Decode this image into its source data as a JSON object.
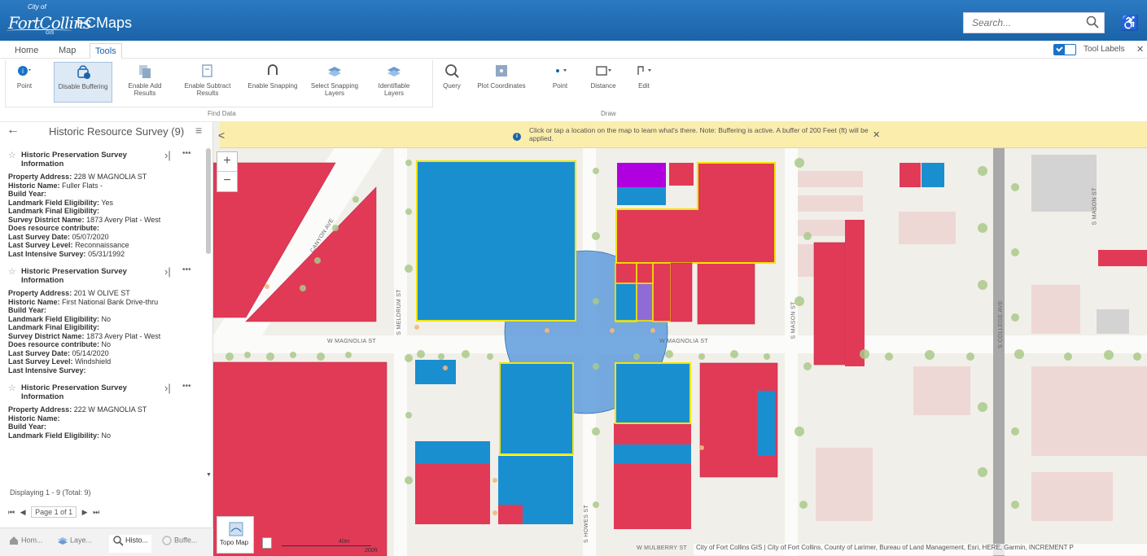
{
  "header": {
    "logo_city": "City of",
    "logo_fort_collins": "FortCollins",
    "logo_app": "FCMaps",
    "logo_gis": "GIS",
    "search_placeholder": "Search...",
    "search_icon": "search-icon",
    "accessibility_icon": "accessibility-icon"
  },
  "tabs": [
    {
      "label": "Home"
    },
    {
      "label": "Map"
    },
    {
      "label": "Tools"
    }
  ],
  "tool_labels": {
    "label": "Tool Labels",
    "checked": true,
    "close": "✕"
  },
  "ribbon": {
    "find_data": {
      "group_label": "Find Data",
      "buttons": [
        {
          "label": "Point",
          "icon": "identify-point-icon"
        },
        {
          "label": "Disable Buffering",
          "icon": "buffer-icon"
        },
        {
          "label": "Enable Add Results",
          "icon": "add-results-icon"
        },
        {
          "label": "Enable Subtract Results",
          "icon": "subtract-results-icon"
        },
        {
          "label": "Enable Snapping",
          "icon": "snapping-icon"
        },
        {
          "label": "Select Snapping Layers",
          "icon": "snapping-layers-icon"
        },
        {
          "label": "Identifiable Layers",
          "icon": "identifiable-layers-icon"
        }
      ]
    },
    "draw": {
      "group_label": "Draw",
      "buttons": [
        {
          "label": "Query",
          "icon": "query-icon"
        },
        {
          "label": "Plot Coordinates",
          "icon": "plot-coordinates-icon"
        },
        {
          "label": "Point",
          "icon": "draw-point-icon"
        },
        {
          "label": "Distance",
          "icon": "distance-icon"
        },
        {
          "label": "Edit",
          "icon": "edit-icon"
        }
      ]
    }
  },
  "panel": {
    "back_icon": "←",
    "title": "Historic Resource Survey (9)",
    "menu_icon": "≡",
    "collapse_icon": "<",
    "results": [
      {
        "title": "Historic Preservation Survey Information",
        "fields": [
          {
            "label": "Property Address:",
            "value": "228 W MAGNOLIA ST"
          },
          {
            "label": "Historic Name:",
            "value": "Fuller Flats -"
          },
          {
            "label": "Build Year:",
            "value": ""
          },
          {
            "label": "Landmark Field Eligibility:",
            "value": "Yes"
          },
          {
            "label": "Landmark Final Eligibility:",
            "value": ""
          },
          {
            "label": "Survey District Name:",
            "value": "1873 Avery Plat - West"
          },
          {
            "label": "Does resource contribute:",
            "value": ""
          },
          {
            "label": "Last Survey Date:",
            "value": "05/07/2020"
          },
          {
            "label": "Last Survey Level:",
            "value": "Reconnaissance"
          },
          {
            "label": "Last Intensive Survey:",
            "value": "05/31/1992"
          }
        ]
      },
      {
        "title": "Historic Preservation Survey Information",
        "fields": [
          {
            "label": "Property Address:",
            "value": "201 W OLIVE ST"
          },
          {
            "label": "Historic Name:",
            "value": "First National Bank Drive-thru"
          },
          {
            "label": "Build Year:",
            "value": ""
          },
          {
            "label": "Landmark Field Eligibility:",
            "value": "No"
          },
          {
            "label": "Landmark Final Eligibility:",
            "value": ""
          },
          {
            "label": "Survey District Name:",
            "value": "1873 Avery Plat - West"
          },
          {
            "label": "Does resource contribute:",
            "value": "No"
          },
          {
            "label": "Last Survey Date:",
            "value": "05/14/2020"
          },
          {
            "label": "Last Survey Level:",
            "value": "Windshield"
          },
          {
            "label": "Last Intensive Survey:",
            "value": ""
          }
        ]
      },
      {
        "title": "Historic Preservation Survey Information",
        "fields": [
          {
            "label": "Property Address:",
            "value": "222 W MAGNOLIA ST"
          },
          {
            "label": "Historic Name:",
            "value": ""
          },
          {
            "label": "Build Year:",
            "value": ""
          },
          {
            "label": "Landmark Field Eligibility:",
            "value": "No"
          }
        ]
      }
    ],
    "display_text": "Displaying 1 - 9 (Total: 9)",
    "pager": {
      "first": "⏮",
      "prev": "◀",
      "page_text": "Page 1 of 1",
      "next": "▶",
      "last": "⏭"
    }
  },
  "bottom_tabs": [
    {
      "label": "Hom...",
      "icon": "home-icon"
    },
    {
      "label": "Laye...",
      "icon": "layers-icon"
    },
    {
      "label": "Histo...",
      "icon": "search-results-icon"
    },
    {
      "label": "Buffe...",
      "icon": "buffer-tab-icon"
    }
  ],
  "map": {
    "notice_text": "Click or tap a location on the map to learn what's there. Note: Buffering is active. A buffer of 200 Feet (ft) will be applied.",
    "notice_close": "✕",
    "zoom_in": "+",
    "zoom_out": "−",
    "basemap_label": "Topo Map",
    "scale_meters": "40m",
    "scale_feet": "200ft",
    "streets": {
      "canyon_ave": "CANYON AVE",
      "w_magnolia_1": "W MAGNOLIA ST",
      "w_magnolia_2": "W MAGNOLIA ST",
      "s_mason": "S MASON ST",
      "w_mulberry": "W MULBERRY ST",
      "s_howes": "S HOWES ST",
      "s_meldrum": "S MELDRUM ST",
      "s_college": "S COLLEGE AVE",
      "s_mason_w": "S MASON ST"
    },
    "attribution": "City of Fort Collins GIS | City of Fort Collins, County of Larimer, Bureau of Land Management, Esri, HERE, Garmin, INCREMENT P",
    "colors": {
      "selected": "#1a8fd0",
      "unselected": "#e03a57",
      "purple": "#b100e0",
      "lavender": "#8f6bd6",
      "outline": "#f2e600",
      "buffer": "#4a90d9"
    }
  }
}
